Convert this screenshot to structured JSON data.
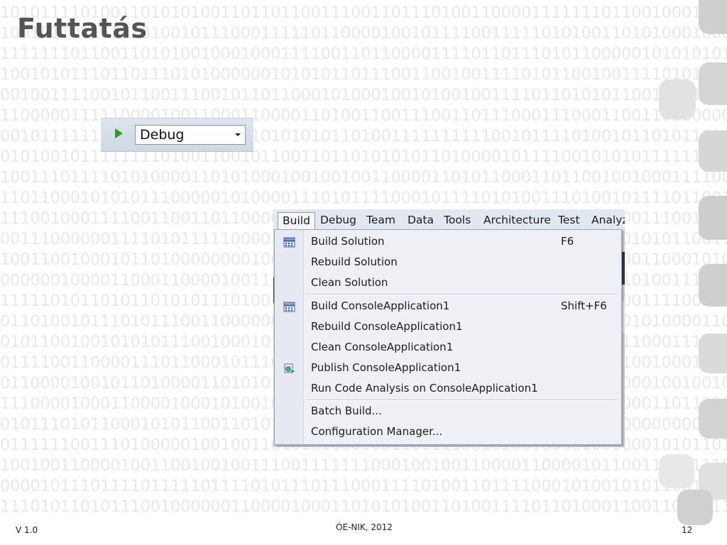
{
  "slide": {
    "title": "Futtatás",
    "footer_left": "V 1.0",
    "footer_center": "ÓE-NIK, 2012",
    "page_number": "12"
  },
  "background_rows": [
    "1010111101001101010100110110110011100110111010011000011111110110010001001011",
    "1001011011111101001011100011111011000010010111100111110101001101010001000010000000101",
    "1111111011001101010010001000111100110110000111101101110101100000101010101",
    "1001010111011011101010000001010101101110011001001111010110010011110101100101",
    "0010011110010110011100101101100010100010010100100111101101010110011101111100",
    "1100000111110000100110001100001101001100111001101110001110001100110110000111100",
    "0010111111000101010101110101010101101001111111111001011110100101101011001101100",
    "0101001011111111010011001011001101101010101101000010111100101010111111101100",
    "1001110111101010000110101000100100100110000110101100011011001001000111100101",
    "1101100010101011100000101000011101011110001011110101001110100101111011001111011",
    "1110010001111001100110110000101101001011101011001101000101111000111001000110101",
    "0011100000011110101111100001011010011010101110011010111000010101010110011001101",
    "1001100100010110100000000100101001011011011010001010101010011000110001010110110",
    "0000001000011000110000100111001001100001011010110101001001011010100111001010111",
    "1111101011010110101011101001011100110101010111110111110000101000111100000111",
    "0110100101110101110011000000100111111011101011010001000100111001010000110101",
    "0101100100101010111001000101100111010001110111111100110101101111000111000101",
    "0111100110000111011000101110010110110101010000101010111111111010010001010101",
    "0110000100101101000011010101010111001010001101110011010010010000010010010011110",
    "1110000100011000010001010010101111011101111101001111011010101100011011100111",
    "0101110101100010101100110101100101011100101010011000110001100000000000000000",
    "0111111001110100000100100110101010001001101111001010010000100100010101101101",
    "1001001100001001100100100111001111111000100100110000110000101100111111110011",
    "0000101110111101111101111010111011100011110100110111100010100101011001101010",
    "1110101101011100100000011000010001101010100110100111101101000110011000011101"
  ],
  "toolbar": {
    "start_icon": "play-icon",
    "configuration": "Debug"
  },
  "menubar": {
    "items": [
      "Build",
      "Debug",
      "Team",
      "Data",
      "Tools",
      "Architecture",
      "Test",
      "Analyz"
    ]
  },
  "build_menu": {
    "items": [
      {
        "label": "Build Solution",
        "shortcut": "F6",
        "icon": "build-solution-icon"
      },
      {
        "label": "Rebuild Solution",
        "shortcut": "",
        "icon": ""
      },
      {
        "label": "Clean Solution",
        "shortcut": "",
        "icon": ""
      },
      {
        "label": "Build ConsoleApplication1",
        "shortcut": "Shift+F6",
        "icon": "build-project-icon"
      },
      {
        "label": "Rebuild ConsoleApplication1",
        "shortcut": "",
        "icon": ""
      },
      {
        "label": "Clean ConsoleApplication1",
        "shortcut": "",
        "icon": ""
      },
      {
        "label": "Publish ConsoleApplication1",
        "shortcut": "",
        "icon": "publish-icon"
      },
      {
        "label": "Run Code Analysis on ConsoleApplication1",
        "shortcut": "",
        "icon": ""
      },
      {
        "label": "Batch Build...",
        "shortcut": "",
        "icon": ""
      },
      {
        "label": "Configuration Manager...",
        "shortcut": "",
        "icon": ""
      }
    ]
  }
}
